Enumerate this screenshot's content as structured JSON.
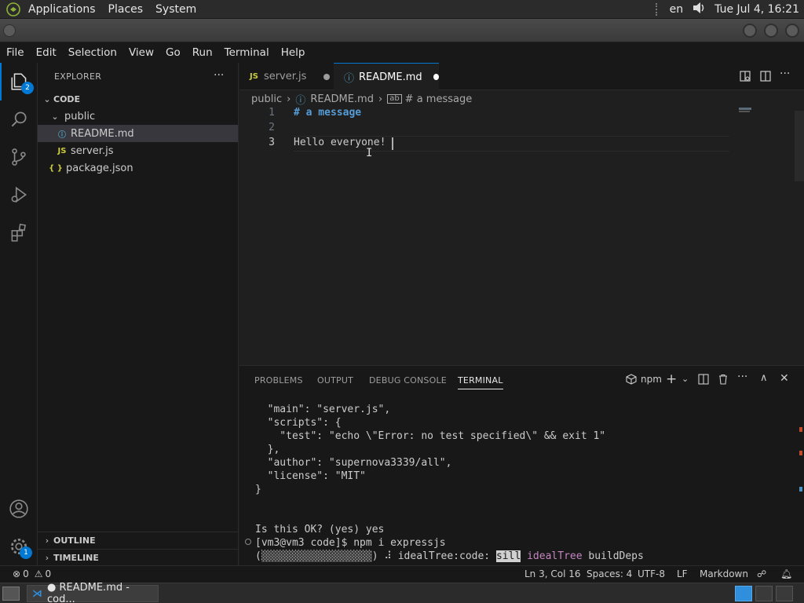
{
  "system_panel": {
    "menus": [
      "Applications",
      "Places",
      "System"
    ],
    "keyboard_layout": "en",
    "datetime": "Tue Jul  4, 16:21"
  },
  "menubar": [
    "File",
    "Edit",
    "Selection",
    "View",
    "Go",
    "Run",
    "Terminal",
    "Help"
  ],
  "activity_bar": {
    "explorer_badge": "2",
    "settings_badge": "1"
  },
  "sidebar": {
    "title": "EXPLORER",
    "more": "···",
    "root_folder": "CODE",
    "items": [
      {
        "label": "public",
        "kind": "folder"
      },
      {
        "label": "README.md",
        "kind": "md"
      },
      {
        "label": "server.js",
        "kind": "js"
      },
      {
        "label": "package.json",
        "kind": "json"
      }
    ],
    "outline": "OUTLINE",
    "timeline": "TIMELINE"
  },
  "tabs": [
    {
      "label": "server.js",
      "icon": "JS"
    },
    {
      "label": "README.md",
      "icon": "ⓘ"
    }
  ],
  "breadcrumb": {
    "folder": "public",
    "file": "README.md",
    "symbol": "# a message"
  },
  "editor": {
    "line_numbers": [
      "1",
      "2",
      "3"
    ],
    "lines": [
      "# a message",
      "",
      "Hello everyone!"
    ]
  },
  "panel": {
    "tabs": [
      "PROBLEMS",
      "OUTPUT",
      "DEBUG CONSOLE",
      "TERMINAL"
    ],
    "terminal_name": "npm",
    "terminal_lines": [
      "  \"main\": \"server.js\",",
      "  \"scripts\": {",
      "    \"test\": \"echo \\\"Error: no test specified\\\" && exit 1\"",
      "  },",
      "  \"author\": \"supernova3339/all\",",
      "  \"license\": \"MIT\"",
      "}",
      "",
      "",
      "Is this OK? (yes) yes"
    ],
    "prompt_line": "[vm3@vm3 code]$ npm i expressjs",
    "progress_line": {
      "bar": "░░░░░░░░░░░░░░░░░░",
      "spinner": "⠼",
      "text1": "idealTree:code:",
      "sill": "sill",
      "ideal": "idealTree",
      "text2": "buildDeps"
    }
  },
  "status_bar": {
    "errors": "0",
    "warnings": "0",
    "position": "Ln 3, Col 16",
    "spaces": "Spaces: 4",
    "encoding": "UTF-8",
    "eol": "LF",
    "language": "Markdown"
  },
  "taskbar": {
    "window_label": "● README.md - cod..."
  },
  "colors": {
    "accent": "#0078d4",
    "md_heading": "#569cd6",
    "js_icon": "#cbcb41",
    "json_icon": "#cbcb41",
    "md_icon": "#519aba",
    "terminal_ideal": "#c586c0"
  }
}
